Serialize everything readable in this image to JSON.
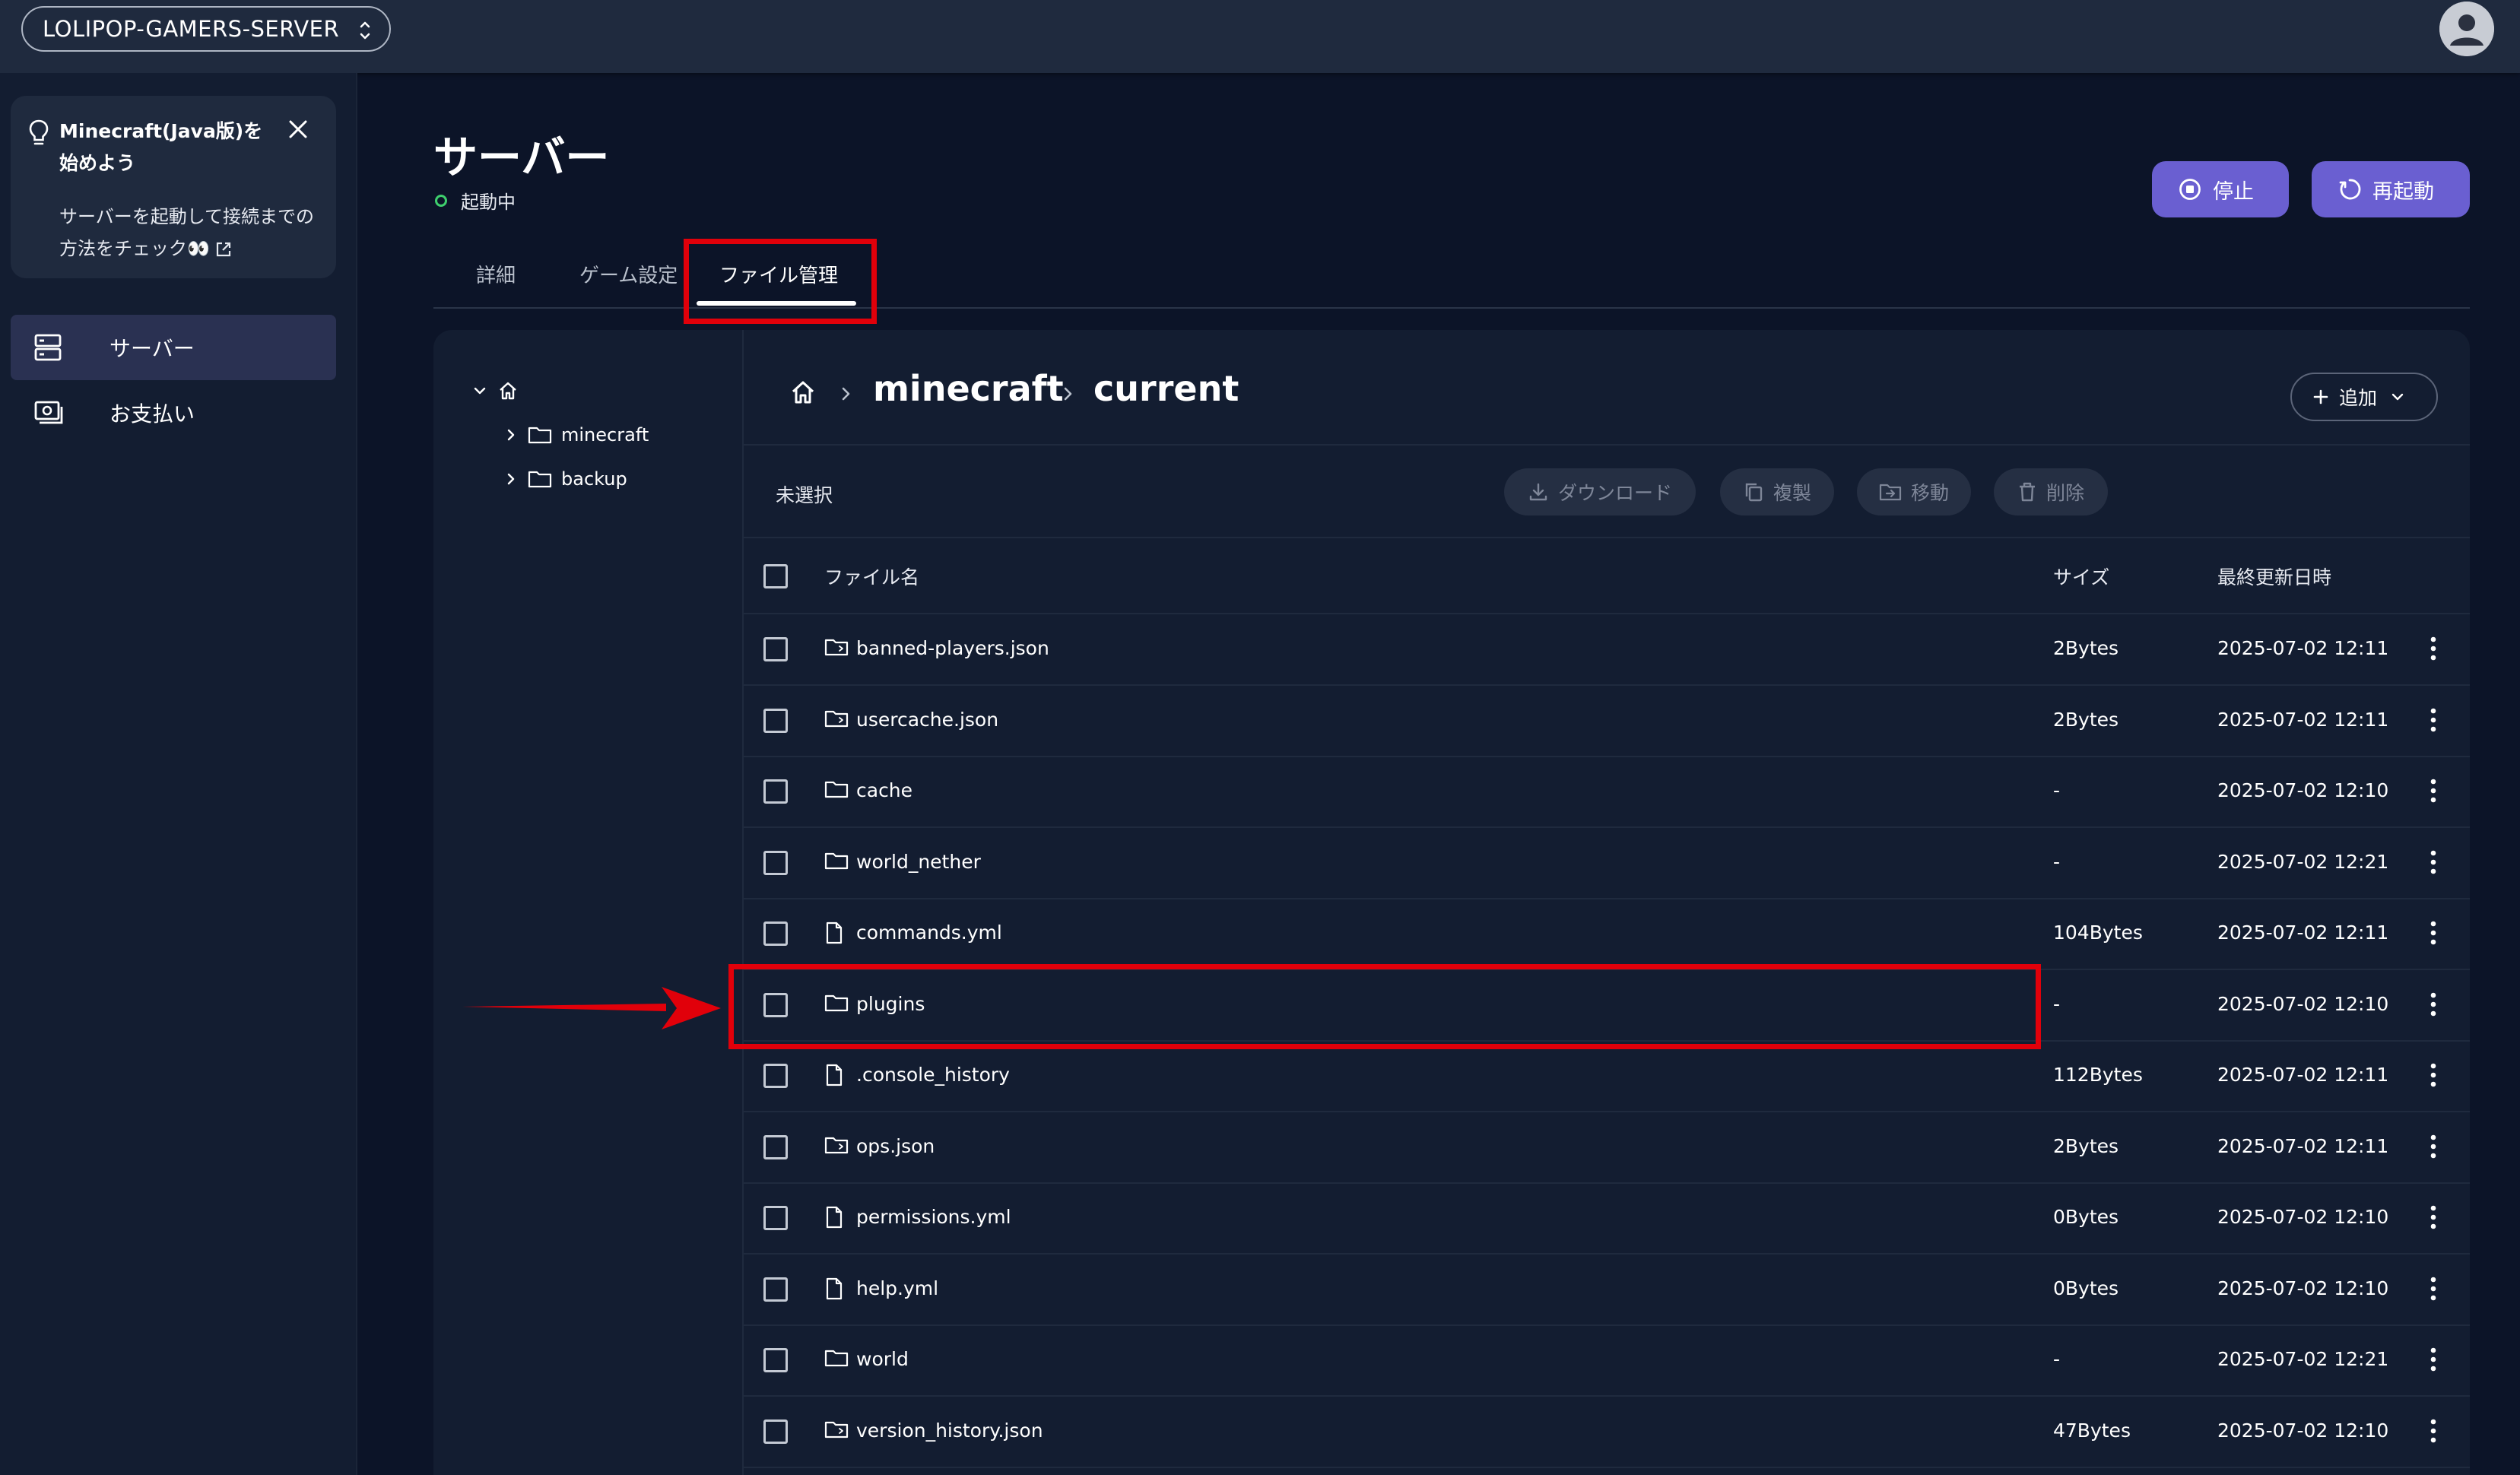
{
  "header": {
    "server_name": "LOLIPOP-GAMERS-SERVER"
  },
  "tip": {
    "title": "Minecraft(Java版)を始めよう",
    "body": "サーバーを起動して接続までの方法をチェック👀"
  },
  "sidebar": {
    "items": [
      {
        "label": "サーバー"
      },
      {
        "label": "お支払い"
      }
    ]
  },
  "page": {
    "title": "サーバー",
    "status": "起動中"
  },
  "actions": {
    "stop_label": "停止",
    "restart_label": "再起動"
  },
  "tabs": [
    {
      "label": "詳細"
    },
    {
      "label": "ゲーム設定"
    },
    {
      "label": "ファイル管理"
    }
  ],
  "tree": {
    "items": [
      {
        "label": "minecraft"
      },
      {
        "label": "backup"
      }
    ]
  },
  "breadcrumb": {
    "segments": [
      "minecraft",
      "current"
    ]
  },
  "add_button": {
    "label": "追加"
  },
  "toolbar": {
    "selection": "未選択",
    "download_label": "ダウンロード",
    "copy_label": "複製",
    "move_label": "移動",
    "delete_label": "削除"
  },
  "table": {
    "headers": {
      "name": "ファイル名",
      "size": "サイズ",
      "modified": "最終更新日時"
    },
    "rows": [
      {
        "name": "banned-players.json",
        "size": "2Bytes",
        "modified": "2025-07-02 12:11",
        "icon": "json-folder-icon"
      },
      {
        "name": "usercache.json",
        "size": "2Bytes",
        "modified": "2025-07-02 12:11",
        "icon": "json-folder-icon"
      },
      {
        "name": "cache",
        "size": "-",
        "modified": "2025-07-02 12:10",
        "icon": "folder-icon"
      },
      {
        "name": "world_nether",
        "size": "-",
        "modified": "2025-07-02 12:21",
        "icon": "folder-icon"
      },
      {
        "name": "commands.yml",
        "size": "104Bytes",
        "modified": "2025-07-02 12:11",
        "icon": "file-icon"
      },
      {
        "name": "plugins",
        "size": "-",
        "modified": "2025-07-02 12:10",
        "icon": "folder-icon"
      },
      {
        "name": ".console_history",
        "size": "112Bytes",
        "modified": "2025-07-02 12:11",
        "icon": "file-icon"
      },
      {
        "name": "ops.json",
        "size": "2Bytes",
        "modified": "2025-07-02 12:11",
        "icon": "json-folder-icon"
      },
      {
        "name": "permissions.yml",
        "size": "0Bytes",
        "modified": "2025-07-02 12:10",
        "icon": "file-icon"
      },
      {
        "name": "help.yml",
        "size": "0Bytes",
        "modified": "2025-07-02 12:10",
        "icon": "file-icon"
      },
      {
        "name": "world",
        "size": "-",
        "modified": "2025-07-02 12:21",
        "icon": "folder-icon"
      },
      {
        "name": "version_history.json",
        "size": "47Bytes",
        "modified": "2025-07-02 12:10",
        "icon": "json-folder-icon"
      }
    ]
  },
  "colors": {
    "accent": "#6a5fd1",
    "highlight": "#e1000a",
    "status": "#3ecf6d",
    "background": "#0c1428"
  }
}
